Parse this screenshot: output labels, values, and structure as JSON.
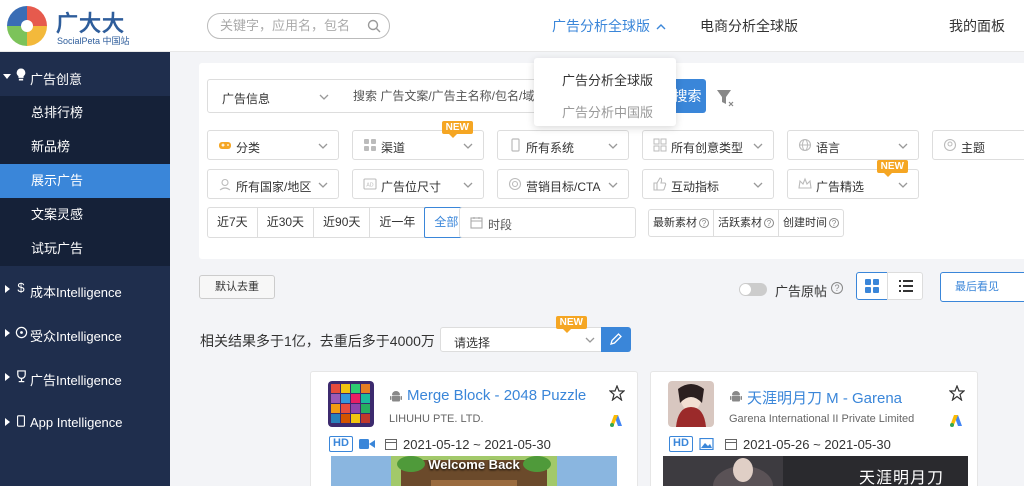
{
  "brand": {
    "name": "广大大",
    "sub": "SocialPeta 中国站"
  },
  "header": {
    "search_placeholder": "关键字，应用名，包名",
    "nav": [
      "广告分析全球版",
      "电商分析全球版",
      "我的面板"
    ],
    "dropdown": [
      "广告分析全球版",
      "广告分析中国版"
    ]
  },
  "sidebar": {
    "sections": [
      {
        "label": "广告创意",
        "icon": "bulb-icon"
      },
      {
        "label": "成本Intelligence",
        "icon": "dollar-icon"
      },
      {
        "label": "受众Intelligence",
        "icon": "target-icon"
      },
      {
        "label": "广告Intelligence",
        "icon": "trophy-icon"
      },
      {
        "label": "App Intelligence",
        "icon": "phone-icon"
      }
    ],
    "sub_items": [
      "总排行榜",
      "新品榜",
      "展示广告",
      "文案灵感",
      "试玩广告"
    ]
  },
  "filters": {
    "ad_info": "广告信息",
    "search_placeholder": "搜索 广告文案/广告主名称/包名/域名/天",
    "search_button": "搜索",
    "new_badge": "NEW",
    "row1": [
      "分类",
      "渠道",
      "所有系统",
      "所有创意类型",
      "语言",
      "主题"
    ],
    "row2": [
      "所有国家/地区",
      "广告位尺寸",
      "营销目标/CTA",
      "互动指标",
      "广告精选"
    ],
    "time_ranges": [
      "近7天",
      "近30天",
      "近90天",
      "近一年",
      "全部"
    ],
    "period_placeholder": "时段",
    "sort": [
      "最新素材",
      "活跃素材",
      "创建时间"
    ]
  },
  "toolbar": {
    "dedup": "默认去重",
    "original_label": "广告原帖",
    "recent": "最后看见"
  },
  "results": {
    "summary": "相关结果多于1亿，去重后多于4000万",
    "choose_placeholder": "请选择"
  },
  "cards": [
    {
      "title": "Merge Block - 2048 Puzzle",
      "developer": "LIHUHU PTE. LTD.",
      "quality": "HD",
      "date_range": "2021-05-12 ~ 2021-05-30",
      "preview_text": "Welcome Back"
    },
    {
      "title": "天涯明月刀 M - Garena",
      "developer": "Garena International II Private Limited",
      "quality": "HD",
      "date_range": "2021-05-26 ~ 2021-05-30",
      "preview_text": "天涯明月刀"
    }
  ],
  "colors": {
    "accent": "#3a86d9",
    "sidebar_bg": "#1f2e4d",
    "new_badge": "#f5a623"
  }
}
